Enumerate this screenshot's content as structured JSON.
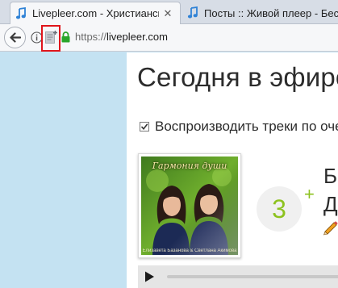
{
  "browser": {
    "tabs": [
      {
        "title": "Livepleer.com - Христианские песни",
        "favicon": "music-note-icon",
        "active": true
      },
      {
        "title": "Посты :: Живой плеер - Бесплатные",
        "favicon": "music-note-icon",
        "active": false
      }
    ],
    "tab_close_glyph": "✕",
    "address_bar": {
      "scheme": "https://",
      "host": "livepleer.com"
    },
    "icons": {
      "back": "back-arrow-icon",
      "site_info": "info-icon",
      "reader_view": "reader-view-icon",
      "secure": "padlock-icon"
    },
    "highlight_color": "#e0151b"
  },
  "page": {
    "title": "Сегодня в эфире",
    "autoplay": {
      "label": "Воспроизводить треки по очереди",
      "checked": true
    },
    "now_playing": {
      "cover_title": "Гармония души",
      "cover_footer": "Елизавета Базанова & Светлана Акимова",
      "track_number": "3",
      "plus": "+",
      "track_title": "Б",
      "artist": "Д",
      "edit_icon": "pencil-icon"
    },
    "player": {
      "play_icon": "play-icon",
      "progress": 0
    },
    "colors": {
      "accent_green": "#8dc21f",
      "page_background": "#c4e2f2"
    }
  }
}
